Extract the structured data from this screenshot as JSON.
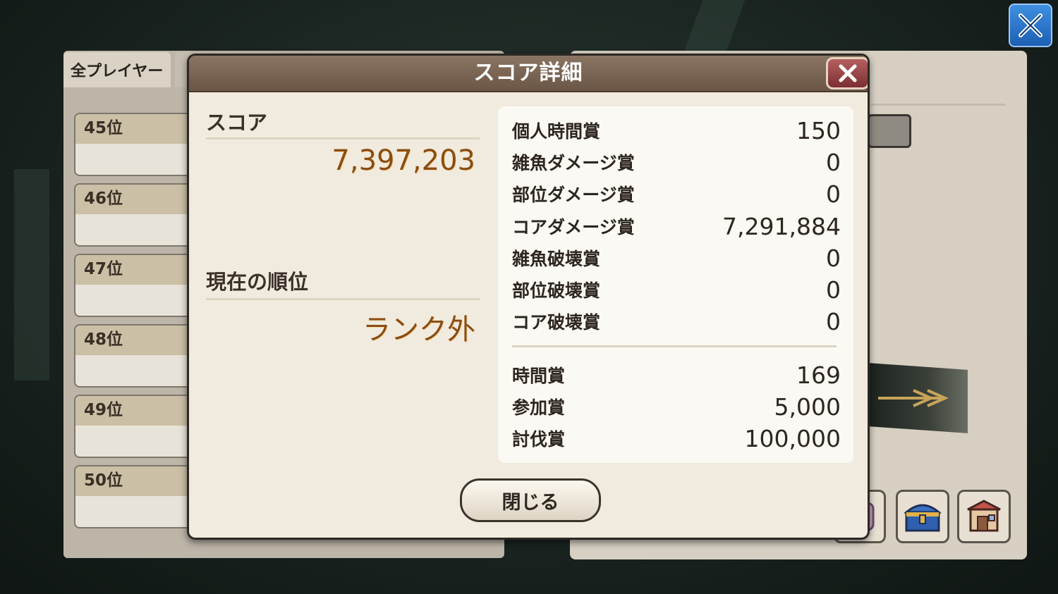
{
  "background": {
    "left_tab_label": "全プレイヤー",
    "ranks": [
      "45位",
      "46位",
      "47位",
      "48位",
      "49位",
      "50位"
    ]
  },
  "dialog": {
    "title": "スコア詳細",
    "score_label": "スコア",
    "score_value": "7,397,203",
    "rank_label": "現在の順位",
    "rank_value": "ランク外",
    "details": [
      {
        "label": "個人時間賞",
        "value": "150"
      },
      {
        "label": "雑魚ダメージ賞",
        "value": "0"
      },
      {
        "label": "部位ダメージ賞",
        "value": "0"
      },
      {
        "label": "コアダメージ賞",
        "value": "7,291,884"
      },
      {
        "label": "雑魚破壊賞",
        "value": "0"
      },
      {
        "label": "部位破壊賞",
        "value": "0"
      },
      {
        "label": "コア破壊賞",
        "value": "0"
      }
    ],
    "bonuses": [
      {
        "label": "時間賞",
        "value": "169"
      },
      {
        "label": "参加賞",
        "value": "5,000"
      },
      {
        "label": "討伐賞",
        "value": "100,000"
      }
    ],
    "close_button": "閉じる"
  },
  "icons": {
    "top_close": "close-x-icon",
    "dialog_close": "close-x-icon",
    "right_buttons": [
      "scroll-icon",
      "treasure-chest-icon",
      "shop-icon"
    ]
  },
  "colors": {
    "header_brown": "#7a6453",
    "value_orange": "#8a4d12",
    "top_close_blue": "#2a72c8",
    "close_red": "#8f3a3c"
  }
}
